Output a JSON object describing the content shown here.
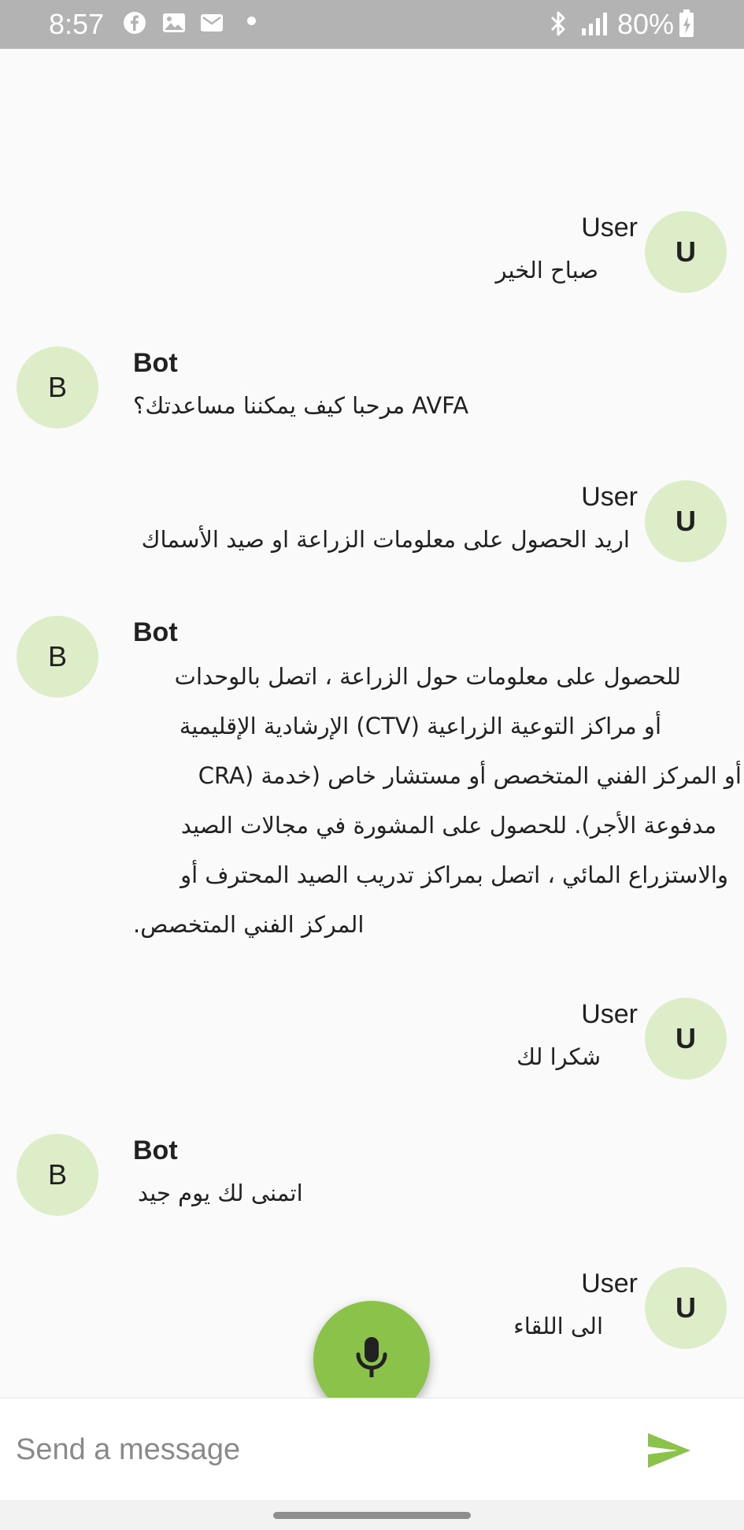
{
  "status_bar": {
    "time": "8:57",
    "battery": "80%",
    "icons": [
      "facebook-icon",
      "gallery-icon",
      "mail-icon",
      "dot-icon",
      "bluetooth-icon",
      "signal-icon",
      "battery-icon"
    ]
  },
  "messages": [
    {
      "sender": "User",
      "avatar": "U",
      "lines": [
        "صباح الخير"
      ]
    },
    {
      "sender": "Bot",
      "avatar": "B",
      "lines": [
        "AVFA مرحبا كيف يمكننا مساعدتك؟"
      ]
    },
    {
      "sender": "User",
      "avatar": "U",
      "lines": [
        "اريد الحصول على معلومات الزراعة او صيد الأسماك"
      ]
    },
    {
      "sender": "Bot",
      "avatar": "B",
      "lines": [
        "للحصول على معلومات حول الزراعة ، اتصل بالوحدات",
        "أو مراكز التوعية الزراعية (CTV) الإرشادية الإقليمية",
        "أو المركز الفني المتخصص أو مستشار خاص (خدمة (CRA",
        "مدفوعة الأجر). للحصول على المشورة في مجالات الصيد",
        "والاستزراع المائي ، اتصل بمراكز تدريب الصيد المحترف أو",
        "المركز الفني المتخصص."
      ]
    },
    {
      "sender": "User",
      "avatar": "U",
      "lines": [
        "شكرا لك"
      ]
    },
    {
      "sender": "Bot",
      "avatar": "B",
      "lines": [
        "اتمنى لك يوم جيد"
      ]
    },
    {
      "sender": "User",
      "avatar": "U",
      "lines": [
        "الى اللقاء"
      ]
    }
  ],
  "input": {
    "placeholder": "Send a message",
    "value": ""
  },
  "colors": {
    "accent": "#8bc34a",
    "avatar_bg": "#dcedc8",
    "status_bar": "#b3b3b3"
  }
}
